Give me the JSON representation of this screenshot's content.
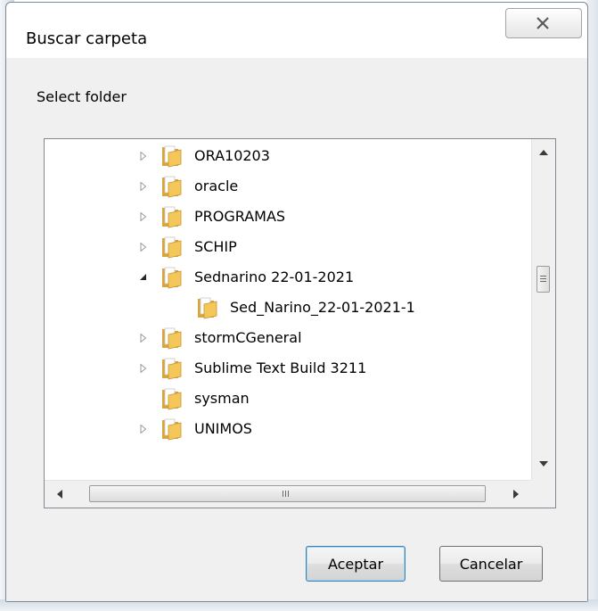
{
  "dialog": {
    "title": "Buscar carpeta",
    "prompt": "Select folder"
  },
  "tree": {
    "items": [
      {
        "label": "ORA10203",
        "expander": "collapsed",
        "level": 1
      },
      {
        "label": "oracle",
        "expander": "collapsed",
        "level": 1
      },
      {
        "label": "PROGRAMAS",
        "expander": "collapsed",
        "level": 1
      },
      {
        "label": "SCHIP",
        "expander": "collapsed",
        "level": 1
      },
      {
        "label": "Sednarino 22-01-2021",
        "expander": "expanded",
        "level": 1
      },
      {
        "label": "Sed_Narino_22-01-2021-1",
        "expander": "none",
        "level": 2
      },
      {
        "label": "stormCGeneral",
        "expander": "collapsed",
        "level": 1
      },
      {
        "label": "Sublime Text Build 3211",
        "expander": "collapsed",
        "level": 1
      },
      {
        "label": "sysman",
        "expander": "none",
        "level": 1
      },
      {
        "label": "UNIMOS",
        "expander": "collapsed",
        "level": 1
      }
    ],
    "vertical_scroll_position": 0.55,
    "horizontal_scroll_position": 0.5
  },
  "buttons": {
    "ok": "Aceptar",
    "cancel": "Cancelar"
  },
  "icons": {
    "close": "close-icon",
    "folder": "folder-icon",
    "expand": "expand-arrow-icon",
    "collapse": "collapse-arrow-icon"
  },
  "colors": {
    "folder_front": "#f3c75a",
    "folder_back": "#d9a53a",
    "dialog_background": "#f0f0f0",
    "tree_background": "#ffffff"
  }
}
